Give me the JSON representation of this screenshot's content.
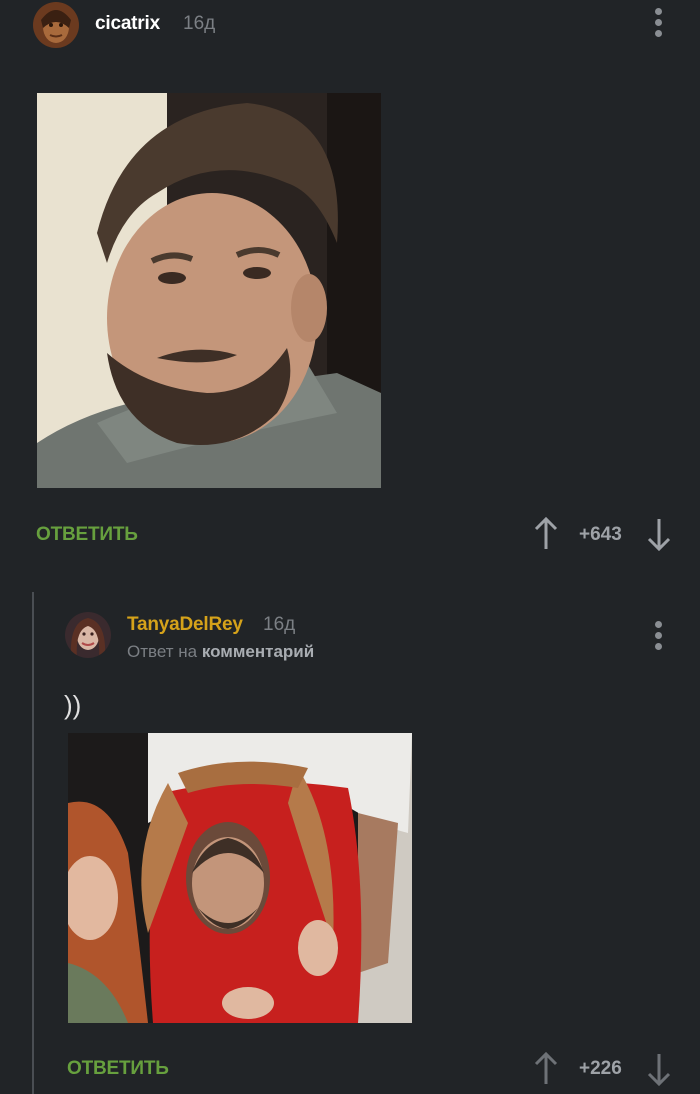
{
  "comment1": {
    "username": "cicatrix",
    "time": "16д",
    "reply_label": "ОТВЕТИТЬ",
    "rating": "+643",
    "avatar_icon": "user-avatar",
    "menu_icon": "more-vertical-icon"
  },
  "comment2": {
    "username": "TanyaDelRey",
    "time": "16д",
    "reply_to_prefix": "Ответ на",
    "reply_to_link": "комментарий",
    "text": "))",
    "reply_label": "ОТВЕТИТЬ",
    "rating": "+226",
    "avatar_icon": "user-avatar",
    "menu_icon": "more-vertical-icon"
  },
  "colors": {
    "background": "#212427",
    "reply_green": "#67a03e",
    "username_gold": "#d5a21a",
    "muted": "#7b7f84"
  }
}
